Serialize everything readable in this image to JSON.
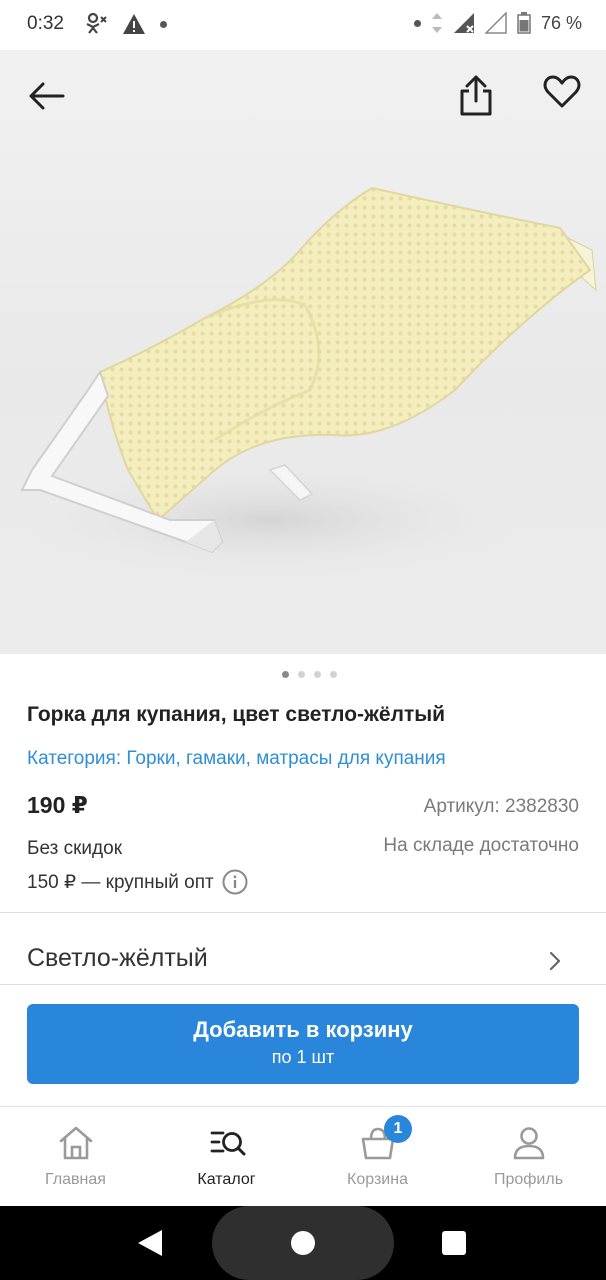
{
  "status_bar": {
    "time": "0:32",
    "battery": "76 %",
    "icons": [
      "ok-icon",
      "warning-icon",
      "dot-icon",
      "wifi-icon",
      "signal-icon",
      "battery-icon"
    ]
  },
  "hero": {
    "pager": {
      "count": 4,
      "active_index": 0
    }
  },
  "product": {
    "title": "Горка для купания, цвет светло-жёлтый",
    "category": "Категория: Горки, гамаки, матрасы для купания",
    "price": "190 ₽",
    "article": "Артикул: 2382830",
    "discount_text": "Без скидок",
    "stock_text": "На складе достаточно",
    "wholesale_text": "150 ₽ — крупный опт"
  },
  "variant": {
    "color_label": "Светло-жёлтый"
  },
  "cart_button": {
    "label": "Добавить в корзину",
    "sub_label": "по 1 шт"
  },
  "tabs": [
    {
      "label": "Главная",
      "icon": "home-icon",
      "active": false
    },
    {
      "label": "Каталог",
      "icon": "catalog-search-icon",
      "active": true
    },
    {
      "label": "Корзина",
      "icon": "basket-icon",
      "active": false
    },
    {
      "label": "Профиль",
      "icon": "profile-icon",
      "active": false
    }
  ],
  "cart_badge": "1",
  "colors": {
    "accent": "#2a86da",
    "link": "#2f8fd6",
    "muted_text": "#7a7a7a"
  }
}
